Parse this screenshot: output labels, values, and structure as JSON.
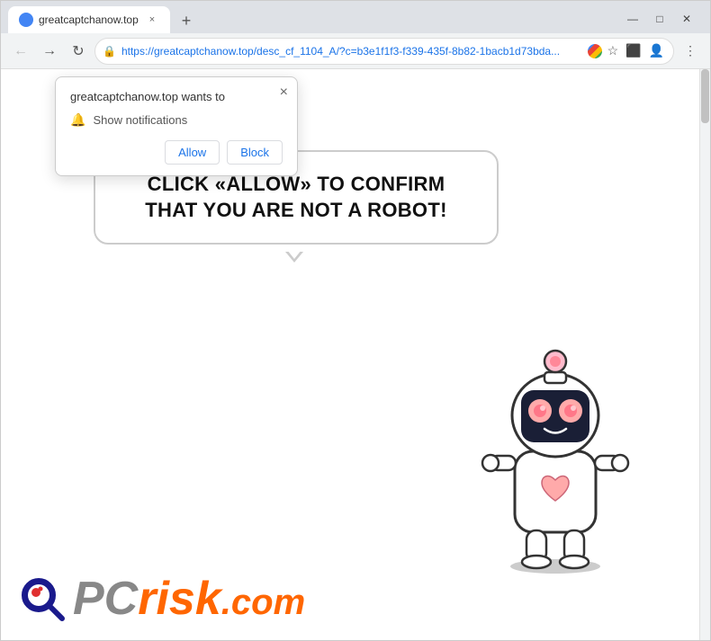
{
  "browser": {
    "tab": {
      "title": "greatcaptchanow.top"
    },
    "address": "https://greatcaptchanow.top/desc_cf_1104_A/?c=b3e1f1f3-f339-435f-8b82-1bacb1d73bda...",
    "address_short": "https://greatcaptchanow.top/desc_cf_1104_A/?c=b3e1f1f3-f339-435f-8b82-1bacb1d73bda...",
    "window_controls": {
      "minimize": "—",
      "maximize": "□",
      "close": "✕"
    }
  },
  "popup": {
    "title": "greatcaptchanow.top wants to",
    "permission": "Show notifications",
    "allow_label": "Allow",
    "block_label": "Block",
    "close_label": "×"
  },
  "page": {
    "bubble_text": "CLICK «ALLOW» TO CONFIRM THAT YOU ARE NOT A ROBOT!",
    "logo_pc": "PC",
    "logo_risk": "risk",
    "logo_dot_com": ".com"
  }
}
